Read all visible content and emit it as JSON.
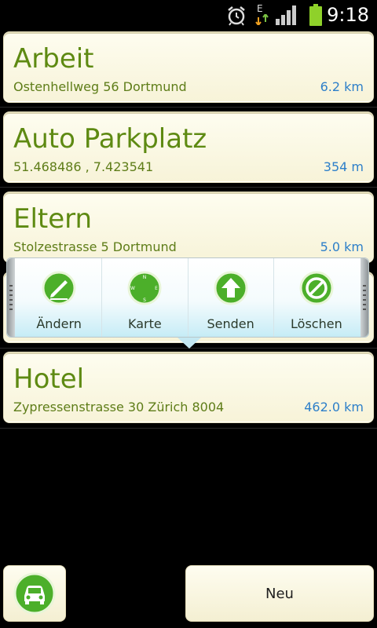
{
  "status_bar": {
    "time": "9:18",
    "icons": [
      "alarm-icon",
      "data-edge-icon",
      "signal-icon",
      "battery-icon"
    ],
    "data_label": "E"
  },
  "locations": [
    {
      "name": "Arbeit",
      "address": "Ostenhellweg 56 Dortmund",
      "distance": "6.2 km"
    },
    {
      "name": "Auto Parkplatz",
      "address": "51.468486 , 7.423541",
      "distance": "354 m"
    },
    {
      "name": "Eltern",
      "address": "Stolzestrasse 5 Dortmund",
      "distance": "5.0 km"
    },
    {
      "name": "Hotel",
      "address": "Zypressenstrasse 30 Zürich 8004",
      "distance": "462.0 km"
    }
  ],
  "quick_actions": [
    {
      "label": "Ändern",
      "icon": "edit-icon"
    },
    {
      "label": "Karte",
      "icon": "compass-icon"
    },
    {
      "label": "Senden",
      "icon": "send-arrow-icon"
    },
    {
      "label": "Löschen",
      "icon": "delete-icon"
    }
  ],
  "compass_letters": {
    "n": "N",
    "e": "E",
    "s": "S",
    "w": "W"
  },
  "bottom": {
    "car_button_icon": "car-icon",
    "new_label": "Neu"
  },
  "colors": {
    "title_green": "#5e8a12",
    "distance_blue": "#2d7fc9",
    "card_bg": "#fefdf0",
    "icon_green": "#4caf2a"
  }
}
